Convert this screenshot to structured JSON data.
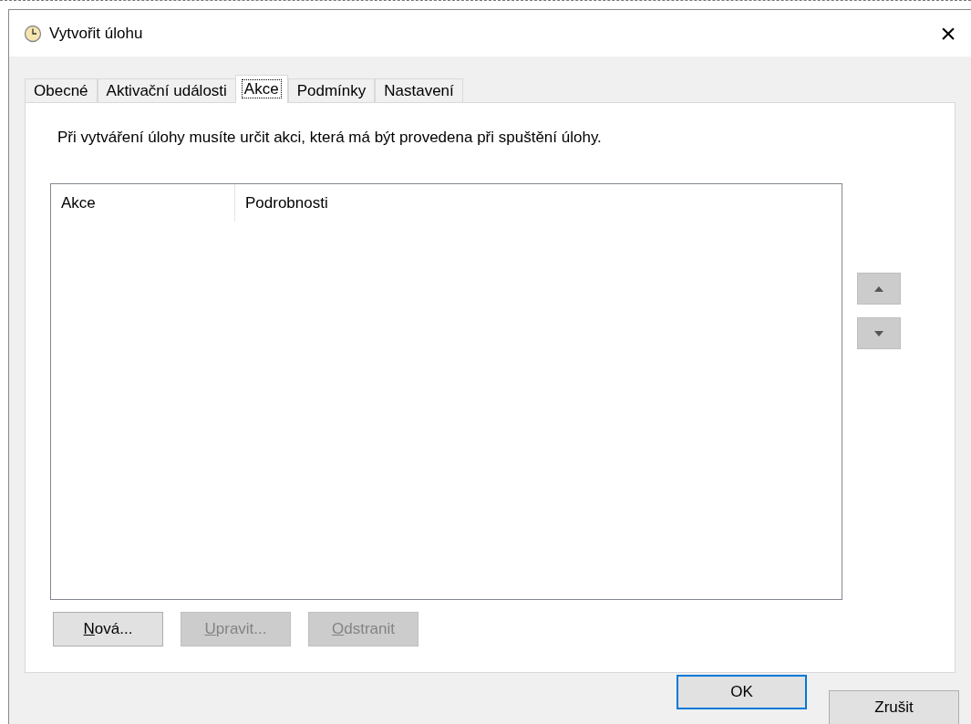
{
  "window": {
    "title": "Vytvořit úlohu",
    "close": "×"
  },
  "tabs": [
    {
      "label": "Obecné",
      "selected": false
    },
    {
      "label": "Aktivační události",
      "selected": false
    },
    {
      "label": "Akce",
      "selected": true
    },
    {
      "label": "Podmínky",
      "selected": false
    },
    {
      "label": "Nastavení",
      "selected": false
    }
  ],
  "description": "Při vytváření úlohy musíte určit akci, která má být provedena při spuštění úlohy.",
  "table": {
    "columns": [
      "Akce",
      "Podrobnosti"
    ]
  },
  "order_buttons": [
    {
      "kind": "up",
      "disabled": true
    },
    {
      "kind": "down",
      "disabled": true
    }
  ],
  "action_buttons": [
    {
      "key": "N",
      "rest": "ová...",
      "disabled": false
    },
    {
      "key": "U",
      "rest": "pravit...",
      "disabled": true
    },
    {
      "key": "O",
      "rest": "dstranit",
      "disabled": true
    }
  ],
  "dialog_buttons": [
    {
      "label": "OK",
      "default": true
    },
    {
      "label": "Zrušit",
      "default": false
    }
  ]
}
